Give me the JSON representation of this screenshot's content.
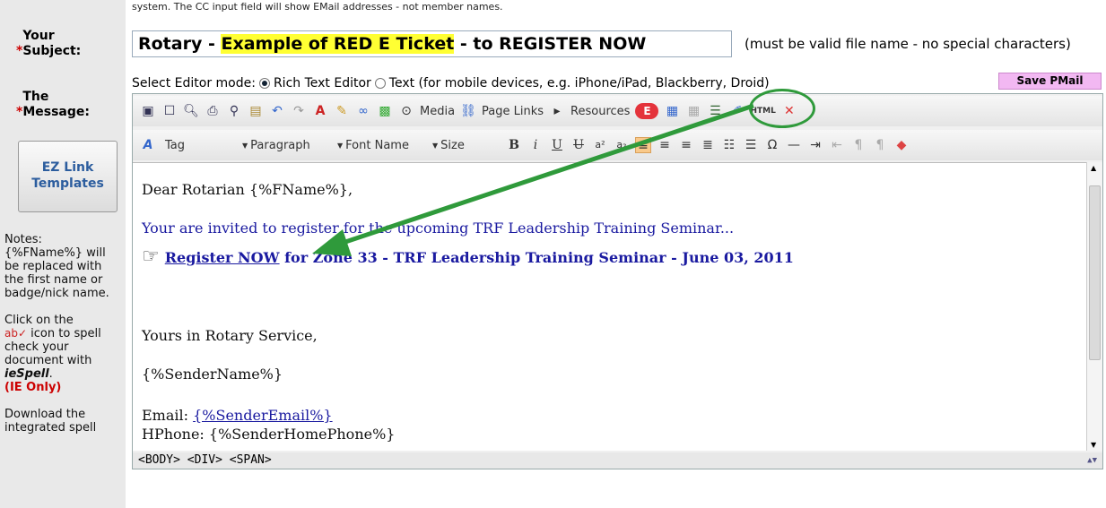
{
  "top_note": "system. The CC input field will show EMail addresses - not member names.",
  "subject": {
    "label": "Your Subject:",
    "required_mark": "*",
    "value_prefix": "Rotary - ",
    "value_highlight": "Example of RED E Ticket",
    "value_suffix": " - to REGISTER NOW",
    "hint": "(must be valid file name - no special characters)"
  },
  "message": {
    "label": "The Message:",
    "required_mark": "*",
    "editor_mode_label": "Select Editor mode:",
    "mode_rich": "Rich Text Editor",
    "mode_text": "Text (for mobile devices, e.g. iPhone/iPad, Blackberry, Droid)",
    "selected_mode": "Rich Text Editor"
  },
  "save_button": "Save PMail",
  "ez_button": "EZ Link Templates",
  "toolbar1": {
    "media": "Media",
    "page_links": "Page Links",
    "resources": "Resources",
    "e_ticket": "E",
    "html": "HTML"
  },
  "toolbar2": {
    "tag": "Tag",
    "paragraph": "Paragraph",
    "font_name": "Font Name",
    "size": "Size"
  },
  "content": {
    "greeting": "Dear Rotarian {%FName%},",
    "invite": "Your are invited to register for the upcoming TRF Leadership Training Seminar...",
    "register_link": "Register NOW",
    "register_rest": " for Zone 33 - TRF Leadership Training Seminar - June 03, 2011",
    "closing": "Yours in Rotary Service,",
    "sender": "{%SenderName%}",
    "email_label": "Email: ",
    "email_value": "{%SenderEmail%}",
    "phone": "HPhone: {%SenderHomePhone%}"
  },
  "status_bar": "<BODY>  <DIV>  <SPAN>",
  "notes": {
    "title": "Notes:",
    "fname_note": "{%FName%} will be replaced with the first name or badge/nick name.",
    "spell_before": "Click on the",
    "spell_after": "icon to spell check your document with",
    "iespell": "ieSpell",
    "ie_only": "(IE Only)",
    "download": "Download the integrated spell"
  },
  "colors": {
    "highlight": "#ffff33",
    "required": "#cc0000",
    "annotation": "#2f9a3b",
    "save_button_bg": "#f2b8f2"
  }
}
